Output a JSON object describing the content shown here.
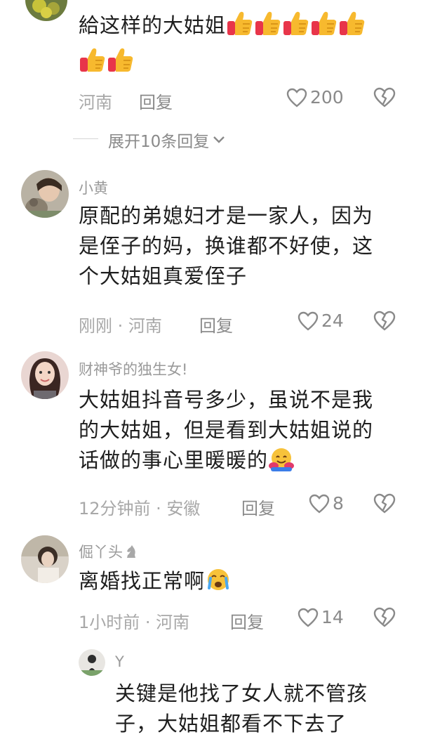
{
  "comment_top": {
    "text": "給这样的大姑姐",
    "location": "河南",
    "reply_label": "回复",
    "likes": "200",
    "thumbs_count": 7,
    "expand_label": "展开10条回复"
  },
  "comments": [
    {
      "username": "小黄",
      "text": "原配的弟媳妇才是一家人，因为是侄子的妈，换谁都不好使，这个大姑姐真爱侄子",
      "line1": "原配的弟媳妇才是一家人，因为",
      "line2": "是侄子的妈，换谁都不好使，这",
      "line3": "个大姑姐真爱侄子",
      "meta": "刚刚 · 河南",
      "reply_label": "回复",
      "likes": "24"
    },
    {
      "username": "财神爷的独生女!",
      "line1": "大姑姐抖音号多少，虽说不是我",
      "line2": "的大姑姐，但是看到大姑姐说的",
      "line3": "话做的事心里暖暖的",
      "meta": "12分钟前 · 安徽",
      "reply_label": "回复",
      "likes": "8"
    },
    {
      "username": "倔丫头",
      "text": "离婚找正常啊",
      "meta": "1小时前 · 河南",
      "reply_label": "回复",
      "likes": "14"
    }
  ],
  "sub_reply": {
    "username": "Y",
    "line1": "关键是他找了女人就不管孩",
    "line2": "子，大姑姐都看不下去了"
  },
  "icons": {
    "like": "heart-outline-icon",
    "dislike": "broken-heart-icon",
    "expand": "chevron-down-icon",
    "thumbs": "thumbs-up-emoji",
    "hug": "hugging-face-emoji",
    "cry": "crying-face-emoji",
    "chess": "chess-knight-icon"
  }
}
